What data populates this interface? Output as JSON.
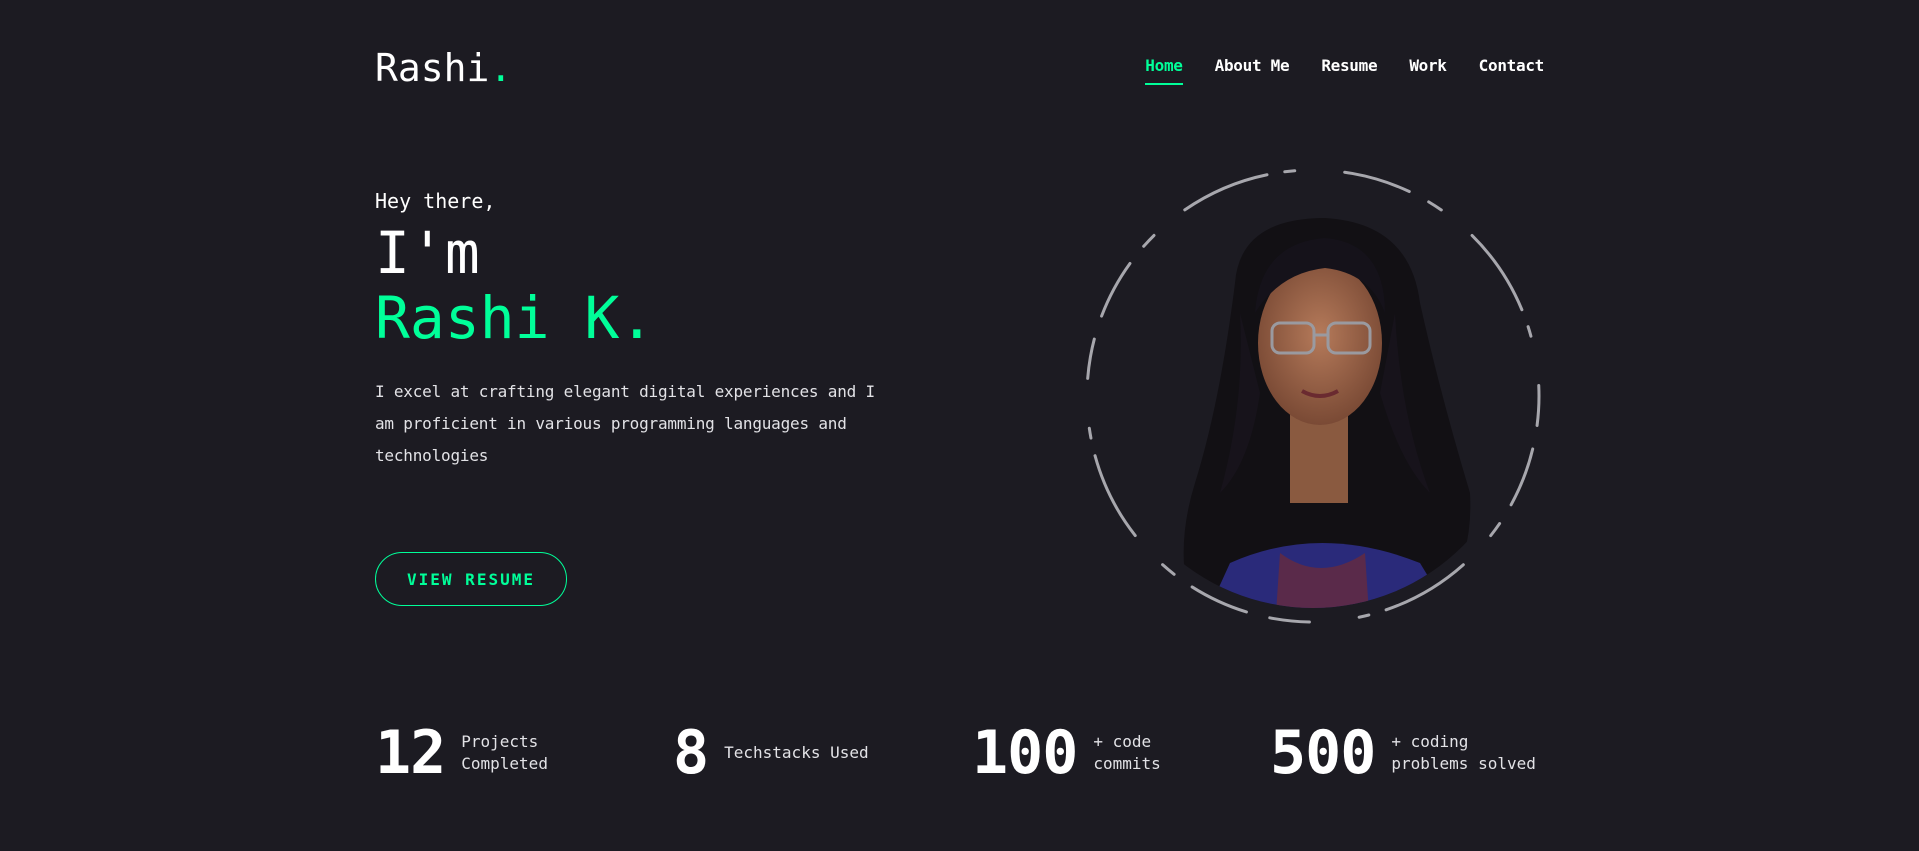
{
  "header": {
    "logo_text": "Rashi",
    "logo_dot": ".",
    "nav": [
      {
        "label": "Home",
        "active": true
      },
      {
        "label": "About Me",
        "active": false
      },
      {
        "label": "Resume",
        "active": false
      },
      {
        "label": "Work",
        "active": false
      },
      {
        "label": "Contact",
        "active": false
      }
    ]
  },
  "hero": {
    "greeting": "Hey there,",
    "title_line1": "I'm",
    "title_line2": "Rashi K.",
    "description": "I excel at crafting elegant digital experiences and I am proficient in various programming languages and technologies",
    "button_label": "VIEW RESUME"
  },
  "stats": [
    {
      "number": "12",
      "label": "Projects\nCompleted"
    },
    {
      "number": "8",
      "label": "Techstacks Used"
    },
    {
      "number": "100",
      "label": "+ code\ncommits"
    },
    {
      "number": "500",
      "label": "+ coding\nproblems solved"
    }
  ],
  "colors": {
    "background": "#1c1b22",
    "accent": "#00ff99",
    "text": "#ffffff"
  }
}
